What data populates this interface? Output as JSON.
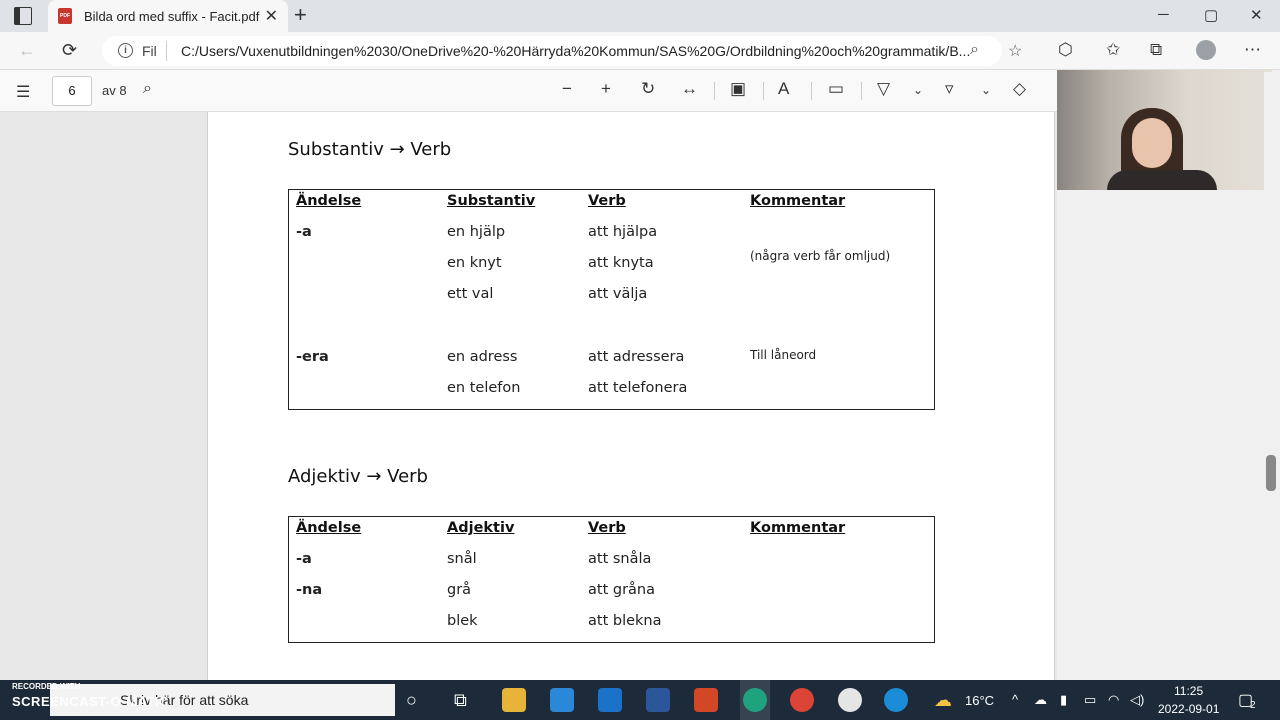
{
  "browser": {
    "tab_title": "Bilda ord med suffix - Facit.pdf",
    "new_tab": "+",
    "win_min": "─",
    "win_max": "▢",
    "win_close": "✕",
    "url_prefix": "Fil",
    "url": "C:/Users/Vuxenutbildningen%2030/OneDrive%20-%20Härryda%20Kommun/SAS%20G/Ordbildning%20och%20grammatik/B..."
  },
  "pdf_toolbar": {
    "page_current": "6",
    "page_total": "av 8"
  },
  "document": {
    "section1": {
      "heading": "Substantiv → Verb",
      "headers": [
        "Ändelse",
        "Substantiv",
        "Verb",
        "Kommentar"
      ],
      "rows": [
        {
          "suffix": "-a",
          "word": "en hjälp",
          "verb": "att hjälpa",
          "comment": ""
        },
        {
          "suffix": "",
          "word": "en knyt",
          "verb": "att knyta",
          "comment": "(några verb får omljud)"
        },
        {
          "suffix": "",
          "word": "ett val",
          "verb": "att välja",
          "comment": ""
        },
        {
          "suffix": "-era",
          "word": "en adress",
          "verb": "att adressera",
          "comment": "Till låneord"
        },
        {
          "suffix": "",
          "word": "en telefon",
          "verb": "att telefonera",
          "comment": ""
        }
      ]
    },
    "section2": {
      "heading": "Adjektiv → Verb",
      "headers": [
        "Ändelse",
        "Adjektiv",
        "Verb",
        "Kommentar"
      ],
      "rows": [
        {
          "suffix": "-a",
          "word": "snål",
          "verb": "att snåla"
        },
        {
          "suffix": "-na",
          "word": "grå",
          "verb": "att gråna"
        },
        {
          "suffix": "",
          "word": "blek",
          "verb": "att blekna"
        }
      ]
    }
  },
  "taskbar": {
    "search_placeholder": "Skriv här för att söka",
    "recorded_with": "RECORDED WITH",
    "screencast": "SCREENCAST-O-MATIC",
    "temperature": "16°C",
    "time": "11:25",
    "date": "2022-09-01",
    "notification_count": "2"
  },
  "colors": {
    "titlebar": "#dfe3e8",
    "taskbar": "#1d2a3a",
    "pdf_icon": "#c8372d"
  }
}
